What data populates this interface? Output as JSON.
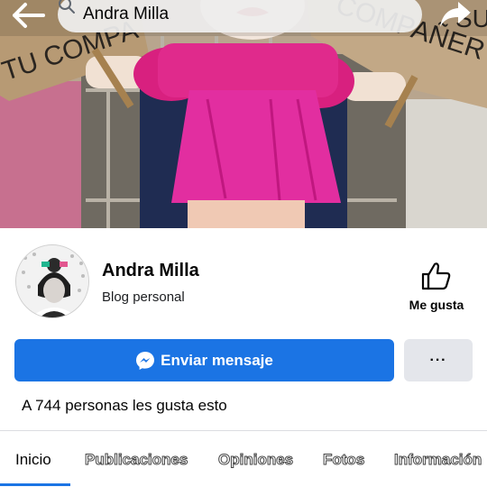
{
  "header": {
    "search_text": "Andra Milla",
    "icons": {
      "back": "back-arrow-icon",
      "search": "search-icon",
      "share": "share-icon"
    }
  },
  "cover": {
    "sign_left_text": "TU COMPA",
    "sign_right_text": "COMPAÑER",
    "sign_right_top_text": "SU"
  },
  "profile": {
    "name": "Andra Milla",
    "category": "Blog personal",
    "like_label": "Me gusta"
  },
  "actions": {
    "message_label": "Enviar mensaje",
    "more_label": "···"
  },
  "likes_text": "A 744 personas les gusta esto",
  "tabs": [
    {
      "label": "Inicio",
      "active": true
    },
    {
      "label": "Publicaciones",
      "active": false
    },
    {
      "label": "Opiniones",
      "active": false
    },
    {
      "label": "Fotos",
      "active": false
    },
    {
      "label": "Información",
      "active": false
    }
  ],
  "colors": {
    "accent": "#1b74e4",
    "secondary_button": "#e4e6eb",
    "pink_dress": "#e0259b",
    "wall_pink": "#c96b8f",
    "cardboard": "#b79a74"
  }
}
